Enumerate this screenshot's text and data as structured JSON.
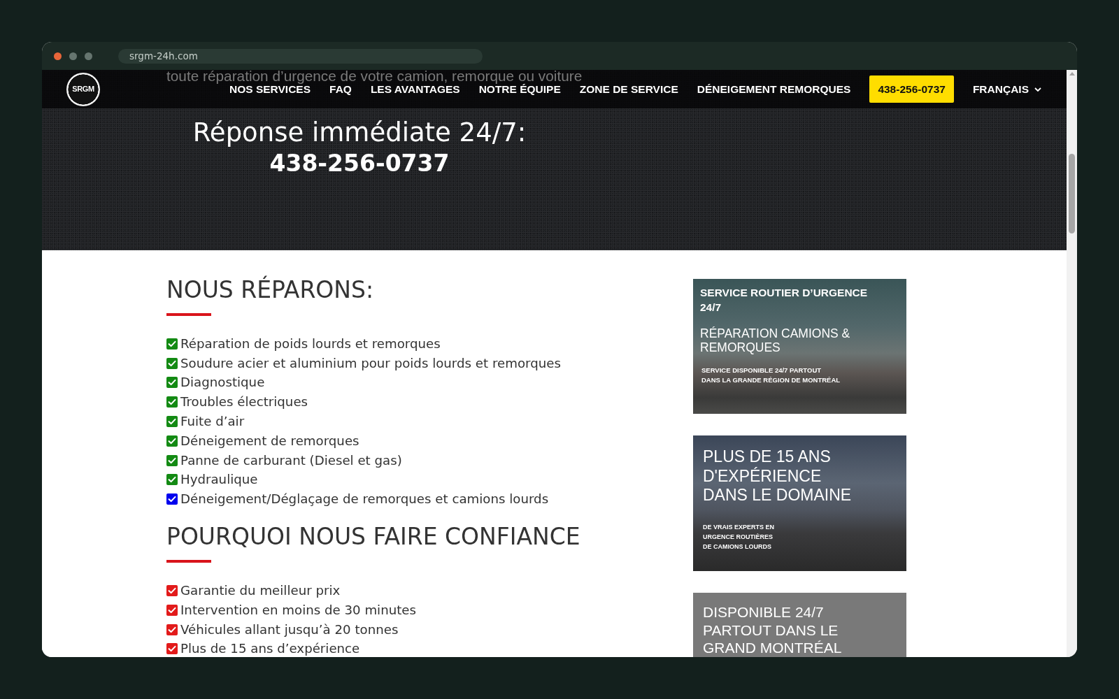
{
  "browser": {
    "address": "srgm-24h.com"
  },
  "header": {
    "logo_text": "SRGM",
    "nav": [
      {
        "label": "NOS SERVICES",
        "kind": "link"
      },
      {
        "label": "FAQ",
        "kind": "link"
      },
      {
        "label": "LES AVANTAGES",
        "kind": "link"
      },
      {
        "label": "NOTRE ÉQUIPE",
        "kind": "link"
      },
      {
        "label": "ZONE DE SERVICE",
        "kind": "link"
      },
      {
        "label": "DÉNEIGEMENT REMORQUES",
        "kind": "link"
      },
      {
        "label": "438-256-0737",
        "kind": "phone"
      },
      {
        "label": "FRANÇAIS",
        "kind": "dropdown"
      }
    ]
  },
  "hero": {
    "intro_text": "toute réparation d’urgence de votre camion, remorque ou voiture",
    "headline": "Réponse immédiate 24/7:",
    "phone": "438-256-0737"
  },
  "sections": [
    {
      "heading": "NOUS RÉPARONS:",
      "items": [
        {
          "text": "Réparation de poids lourds et remorques",
          "color": "#138a13"
        },
        {
          "text": "Soudure acier et aluminium pour poids lourds et remorques",
          "color": "#138a13"
        },
        {
          "text": "Diagnostique",
          "color": "#138a13"
        },
        {
          "text": "Troubles électriques",
          "color": "#138a13"
        },
        {
          "text": "Fuite d’air",
          "color": "#138a13"
        },
        {
          "text": "Déneigement de remorques",
          "color": "#138a13"
        },
        {
          "text": "Panne de carburant (Diesel et gas)",
          "color": "#138a13"
        },
        {
          "text": "Hydraulique",
          "color": "#138a13"
        },
        {
          "text": "Déneigement/Déglaçage de remorques et camions lourds",
          "color": "#0000ee"
        }
      ]
    },
    {
      "heading": "POURQUOI NOUS FAIRE CONFIANCE",
      "items": [
        {
          "text": "Garantie du meilleur prix",
          "color": "#e21a1a"
        },
        {
          "text": "Intervention en moins de 30 minutes",
          "color": "#e21a1a"
        },
        {
          "text": "Véhicules allant jusqu’à 20 tonnes",
          "color": "#e21a1a"
        },
        {
          "text": "Plus de 15 ans d’expérience",
          "color": "#e21a1a"
        }
      ]
    }
  ],
  "banners": [
    {
      "kind": "stacked",
      "title": "SERVICE ROUTIER D’URGENCE\n24/7",
      "subtitle": "RÉPARATION CAMIONS &\nREMORQUES",
      "note": "SERVICE DISPONIBLE 24/7 PARTOUT\nDANS LA GRANDE RÉGION DE MONTRÉAL"
    },
    {
      "kind": "headline",
      "title": "PLUS DE 15 ANS\nD'EXPÉRIENCE\nDANS LE DOMAINE",
      "note": "DE VRAIS EXPERTS EN\nURGENCE ROUTIÈRES\nDE CAMIONS LOURDS"
    },
    {
      "kind": "headline",
      "title": "DISPONIBLE 24/7\nPARTOUT DANS LE\nGRAND MONTRÉAL"
    }
  ]
}
